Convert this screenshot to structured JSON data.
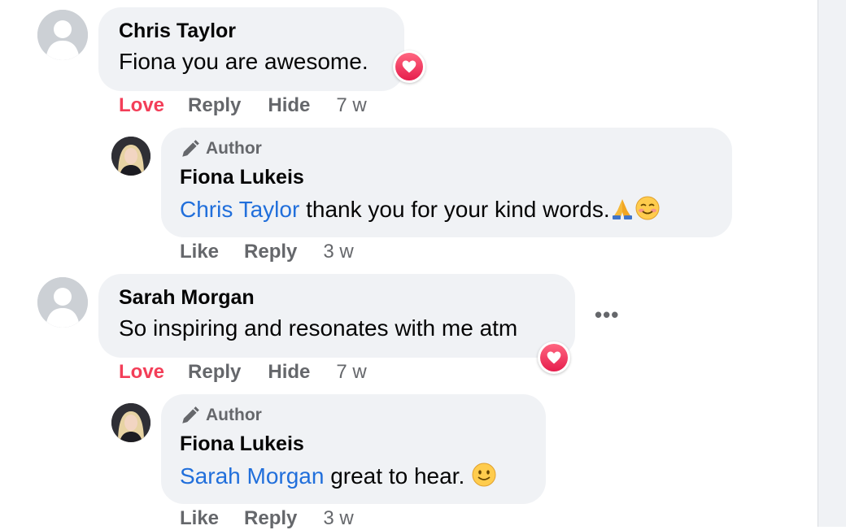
{
  "comments": [
    {
      "author": "Chris Taylor",
      "text": "Fiona you are awesome.",
      "actions": {
        "love": "Love",
        "reply": "Reply",
        "hide": "Hide",
        "time": "7 w"
      },
      "reply": {
        "badge": "Author",
        "author": "Fiona Lukeis",
        "mention": "Chris Taylor",
        "text": " thank you for your kind words.",
        "emojis": [
          "folded-hands",
          "smiling-face-blushing"
        ],
        "actions": {
          "like": "Like",
          "reply": "Reply",
          "time": "3 w"
        }
      }
    },
    {
      "author": "Sarah Morgan",
      "text": "So inspiring and resonates with me atm",
      "more": "•••",
      "actions": {
        "love": "Love",
        "reply": "Reply",
        "hide": "Hide",
        "time": "7 w"
      },
      "reply": {
        "badge": "Author",
        "author": "Fiona Lukeis",
        "mention": "Sarah Morgan",
        "text": " great to hear. ",
        "emojis": [
          "slightly-smiling-face"
        ],
        "actions": {
          "like": "Like",
          "reply": "Reply",
          "time": "3 w"
        }
      }
    }
  ],
  "colors": {
    "love": "#f33e58",
    "mention": "#216fdb",
    "bubble": "#f0f2f5",
    "meta": "#65676b"
  }
}
